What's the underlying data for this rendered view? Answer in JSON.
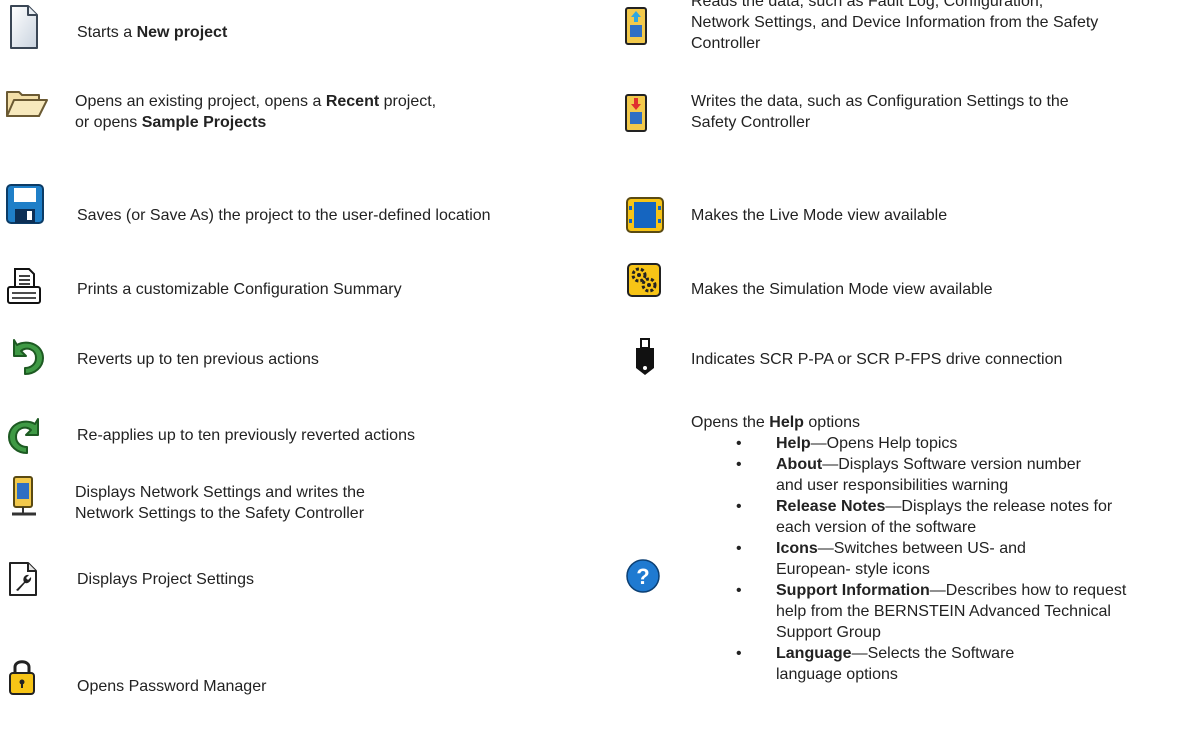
{
  "left": [
    {
      "id": "new",
      "icon": "new-document-icon",
      "parts": [
        "Starts a ",
        {
          "b": "New project"
        }
      ]
    },
    {
      "id": "open",
      "icon": "open-folder-icon",
      "parts": [
        "Opens an existing project, opens a ",
        {
          "b": "Recent"
        },
        " project,",
        "\n",
        "or opens ",
        {
          "b": "Sample Projects"
        }
      ]
    },
    {
      "id": "save",
      "icon": "save-disk-icon",
      "parts": [
        "Saves (or Save As) the project to the user-defined location"
      ]
    },
    {
      "id": "print",
      "icon": "printer-icon",
      "parts": [
        "Prints a customizable Configuration Summary"
      ]
    },
    {
      "id": "undo",
      "icon": "undo-arrow-icon",
      "parts": [
        "Reverts up to ten previous actions"
      ]
    },
    {
      "id": "redo",
      "icon": "redo-arrow-icon",
      "parts": [
        "Re-applies up to ten previously reverted actions"
      ]
    },
    {
      "id": "network",
      "icon": "network-settings-icon",
      "parts": [
        "Displays Network Settings and writes the",
        "\n",
        "Network Settings to the Safety Controller"
      ]
    },
    {
      "id": "project-settings",
      "icon": "project-settings-icon",
      "parts": [
        "Displays Project Settings"
      ]
    },
    {
      "id": "password",
      "icon": "padlock-icon",
      "parts": [
        "Opens Password Manager"
      ]
    }
  ],
  "right": [
    {
      "id": "read",
      "icon": "read-from-controller-icon",
      "parts": [
        "Reads the data, such as Fault Log, Configuration,",
        "\n",
        "Network Settings, and Device Information from the Safety",
        "\n",
        "Controller"
      ]
    },
    {
      "id": "write",
      "icon": "write-to-controller-icon",
      "parts": [
        "Writes the data, such as Configuration Settings to the",
        "\n",
        "Safety Controller"
      ]
    },
    {
      "id": "live",
      "icon": "live-mode-icon",
      "parts": [
        "Makes the Live Mode view available"
      ]
    },
    {
      "id": "simulation",
      "icon": "simulation-gears-icon",
      "parts": [
        "Makes the Simulation Mode view available"
      ]
    },
    {
      "id": "drive",
      "icon": "usb-drive-icon",
      "parts": [
        "Indicates SCR P-PA or SCR P-FPS drive connection"
      ]
    }
  ],
  "help": {
    "icon": "help-question-icon",
    "intro": [
      "Opens the ",
      {
        "b": "Help"
      },
      " options"
    ],
    "items": [
      {
        "b": "Help",
        "rest": [
          "—Opens Help topics"
        ]
      },
      {
        "b": "About",
        "rest": [
          "—Displays Software version number",
          "and user responsibilities warning"
        ]
      },
      {
        "b": "Release Notes",
        "rest": [
          "—Displays the release notes for",
          "each version of the software"
        ]
      },
      {
        "b": "Icons",
        "rest": [
          "—Switches between US- and",
          "European- style icons"
        ]
      },
      {
        "b": "Support Information",
        "rest": [
          "—Describes how to request",
          "help from the BERNSTEIN Advanced Technical",
          "Support Group"
        ]
      },
      {
        "b": "Language",
        "rest": [
          "—Selects the Software",
          "language options"
        ]
      }
    ]
  }
}
